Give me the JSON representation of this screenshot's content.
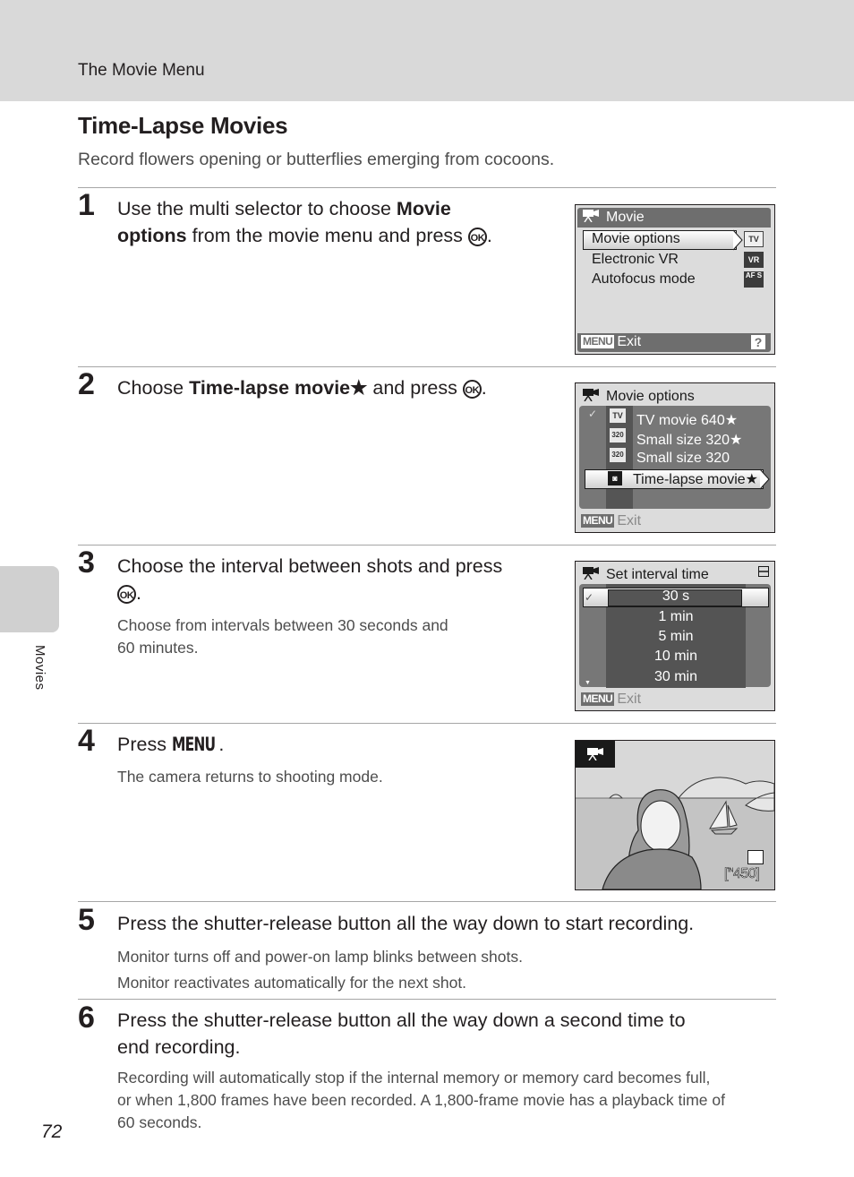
{
  "header": {
    "section_title": "The Movie Menu"
  },
  "page": {
    "title": "Time-Lapse Movies",
    "subtitle": "Record flowers opening or butterflies emerging from cocoons.",
    "side_tab_label": "Movies",
    "page_number": "72"
  },
  "steps": [
    {
      "number": "1",
      "text_parts": [
        "Use the multi selector to choose ",
        "Movie",
        "options",
        " from the movie menu and press ",
        "."
      ],
      "ok_label": "OK"
    },
    {
      "number": "2",
      "text_parts": [
        "Choose ",
        "Time-lapse movie★",
        " and press ",
        "."
      ],
      "ok_label": "OK"
    },
    {
      "number": "3",
      "text_parts": [
        "Choose the interval between shots and press",
        "."
      ],
      "ok_label": "OK",
      "note_lines": [
        "Choose from intervals between 30 seconds and",
        "60 minutes."
      ]
    },
    {
      "number": "4",
      "text_parts": [
        "Press ",
        "MENU",
        "."
      ],
      "note": "The camera returns to shooting mode."
    },
    {
      "number": "5",
      "text": "Press the shutter-release button all the way down to start recording.",
      "note_lines": [
        "Monitor turns off and power-on lamp blinks between shots.",
        "Monitor reactivates automatically for the next shot."
      ]
    },
    {
      "number": "6",
      "text_lines": [
        "Press the shutter-release button all the way down a second time to",
        "end recording."
      ],
      "note_lines": [
        "Recording will automatically stop if the internal memory or memory card becomes full,",
        "or when 1,800 frames have been recorded. A 1,800-frame movie has a playback time of",
        "60 seconds."
      ]
    }
  ],
  "screens": {
    "movie_menu": {
      "title": "Movie",
      "items": [
        {
          "label": "Movie options",
          "icon": "TV",
          "selected": true
        },
        {
          "label": "Electronic VR",
          "icon": "VR",
          "selected": false
        },
        {
          "label": "Autofocus mode",
          "icon": "AF S",
          "selected": false
        }
      ],
      "footer_badge": "MENU",
      "footer_label": "Exit",
      "help": "?"
    },
    "movie_options": {
      "title": "Movie options",
      "items": [
        {
          "label": "TV movie 640★",
          "icon": "TV",
          "checked": true
        },
        {
          "label": "Small size 320★",
          "icon": "320",
          "checked": false
        },
        {
          "label": "Small size 320",
          "icon": "320",
          "checked": false
        },
        {
          "label": "Time-lapse movie★",
          "icon": "TL",
          "checked": false,
          "selected": true
        }
      ],
      "footer_badge": "MENU",
      "footer_label": "Exit"
    },
    "interval": {
      "title": "Set interval time",
      "items": [
        "30 s",
        "1 min",
        "5 min",
        "10 min",
        "30 min"
      ],
      "selected": "30 s",
      "footer_badge": "MENU",
      "footer_label": "Exit"
    },
    "shooting": {
      "remaining_prefix": "IN",
      "remaining": "450"
    }
  }
}
